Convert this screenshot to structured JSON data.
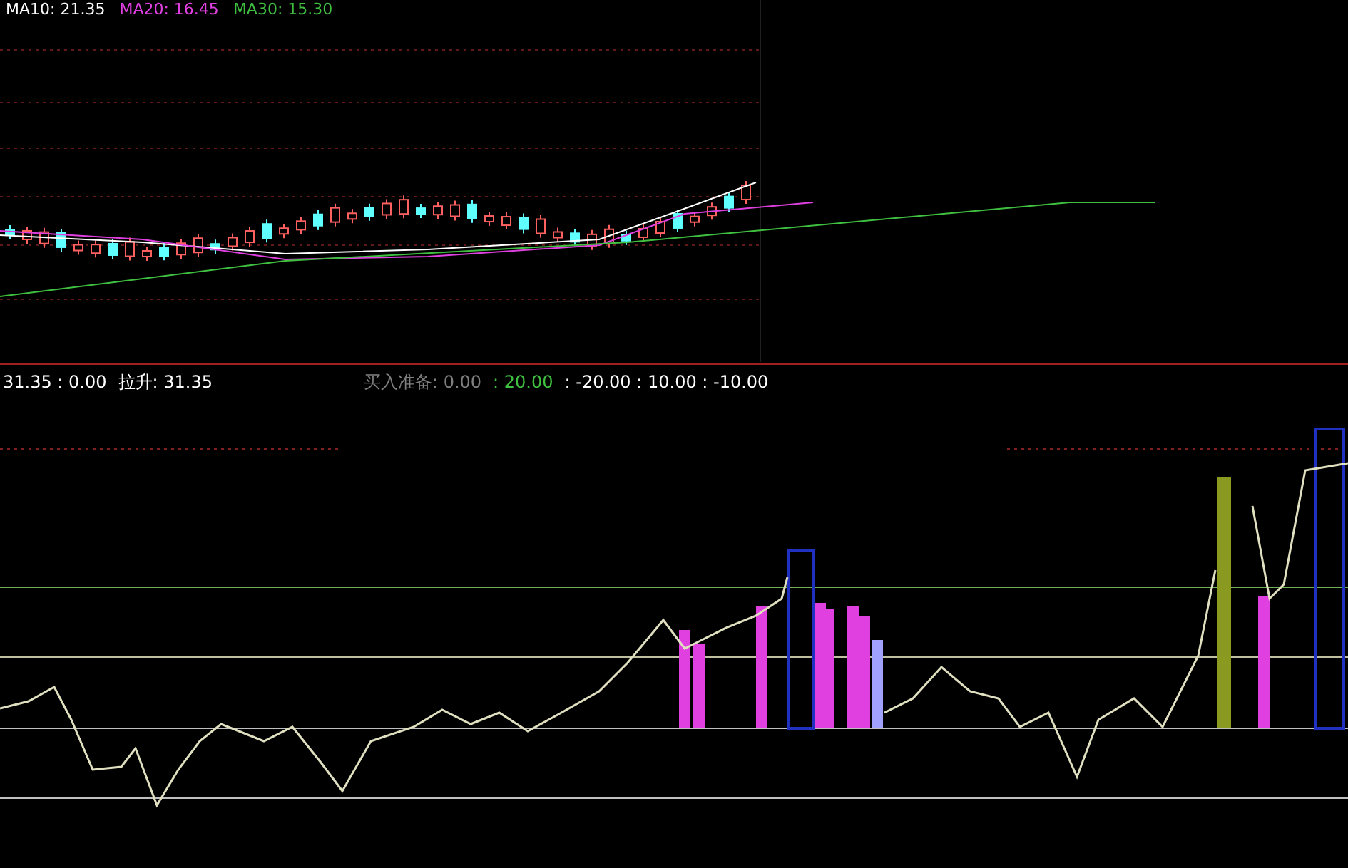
{
  "upper_legend": [
    {
      "label": "MA10: 21.35",
      "color": "#ffffff"
    },
    {
      "label": "MA20: 16.45",
      "color": "#e040e0"
    },
    {
      "label": "MA30: 15.30",
      "color": "#40c040"
    }
  ],
  "lower_legend": [
    {
      "label": "31.35 : 0.00",
      "color": "#ffffff"
    },
    {
      "label": "拉升: 31.35",
      "color": "#ffffff"
    },
    {
      "label": "买入准备: 0.00",
      "color": "#808080"
    },
    {
      "label": ": 20.00",
      "color": "#40c040"
    },
    {
      "label": ": -20.00 : 10.00 : -10.00",
      "color": "#ffffff"
    }
  ]
}
